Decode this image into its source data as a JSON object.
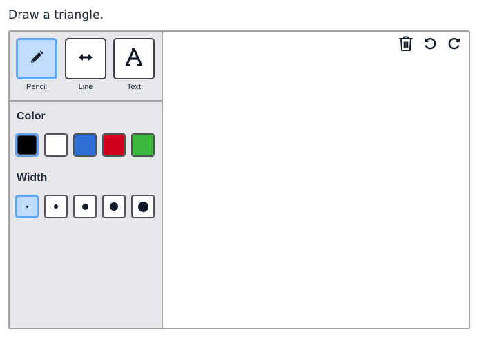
{
  "instruction": "Draw a triangle.",
  "tools": [
    {
      "label": "Pencil",
      "icon": "pencil-icon",
      "active": true
    },
    {
      "label": "Line",
      "icon": "double-arrow-icon",
      "active": false
    },
    {
      "label": "Text",
      "icon": "letter-a-icon",
      "active": false
    }
  ],
  "color_section": {
    "title": "Color",
    "swatches": [
      "#000000",
      "#ffffff",
      "#2f6fd6",
      "#d0021b",
      "#3cb83c"
    ],
    "selected_index": 0
  },
  "width_section": {
    "title": "Width",
    "sizes": [
      "1",
      "2",
      "3",
      "4",
      "5"
    ],
    "selected_index": 0
  },
  "toolbar": {
    "delete_icon": "trash-icon",
    "undo_icon": "undo-icon",
    "redo_icon": "redo-icon"
  },
  "colors": {
    "accent": "#60a5fa",
    "accent_fill": "#bfdbfe",
    "sidebar_bg": "#e5e7eb"
  }
}
